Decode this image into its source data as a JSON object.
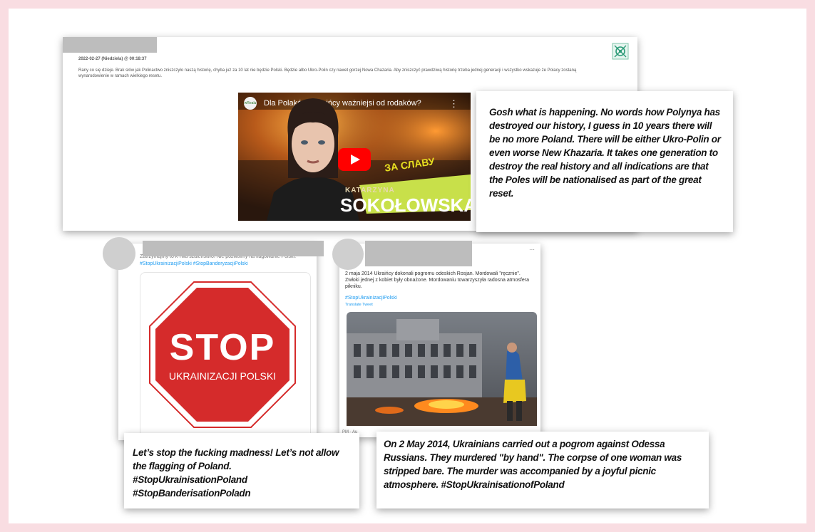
{
  "colors": {
    "frame": "#f9dde2",
    "stop_red": "#d52b2b",
    "link_blue": "#1d9bf0",
    "redaction": "#bdbdbd"
  },
  "forum_post": {
    "date": "2022-02-27 (Niedziela) @ 00:18:37",
    "text": "Rany co się dzieje. Brak słów jak Polinactwo zniszczyło naszą historię, chyba już za 10 lat nie będzie Polski. Będzie albo Ukro-Polin czy nawet gorzej Nowa Chazaria. Aby zniszczyć prawdziwą historię trzeba jednej generacji i wszystko wskazuje że Polacy zostaną wynarodowienie w ramach wielkiego resetu.",
    "icon": "network-logo-icon"
  },
  "video": {
    "channel": "wRealu",
    "title": "Dla Polaków Ukraińcy ważniejsi od rodaków?",
    "menu": "⋮",
    "overlay_small": "KATARZYNA",
    "overlay_big": "SOKOŁOWSKA",
    "banner": "ЗА СЛАВУ",
    "play_icon": "youtube-play-icon"
  },
  "caption1": "Gosh what is happening. No words how Polynya has destroyed our history, I guess in 10 years there will be no more Poland. There will be either Ukro-Polin or even worse New Khazaria. It takes one generation to destroy the real history and all indications are that the Poles will be nationalised as part of the great reset.",
  "tweet1": {
    "text": "Zatrzymajmy to k*rwa szaleństwo! Nie pozwólmy na flagowanie Polski.",
    "tags": "#StopUkrainizacjiPolski #StopBanderyzacjiPolski",
    "sign_main": "STOP",
    "sign_sub": "UKRAINIZACJI POLSKI"
  },
  "caption2": "Let’s stop the fucking madness! Let’s not allow the flagging of Poland. #StopUkrainisationPoland #StopBanderisationPoladn",
  "tweet2": {
    "menu": "···",
    "text": "2 maja 2014 Ukraińcy dokonali pogromu odeskich Rosjan. Mordowali \"ręcznie\". Zwłoki jednej z kobiet były obnażone. Mordowaniu towarzyszyła radosna atmosfera pikniku.",
    "tag": "#StopUkrainizacjiPolski",
    "translate": "Translate Tweet",
    "time": "PM · Au"
  },
  "caption3": "On 2 May 2014, Ukrainians carried out a pogrom against Odessa Russians. They murdered \"by hand\". The corpse of one woman was stripped bare. The murder was accompanied by a joyful picnic atmosphere. #StopUkrainisationofPoland"
}
